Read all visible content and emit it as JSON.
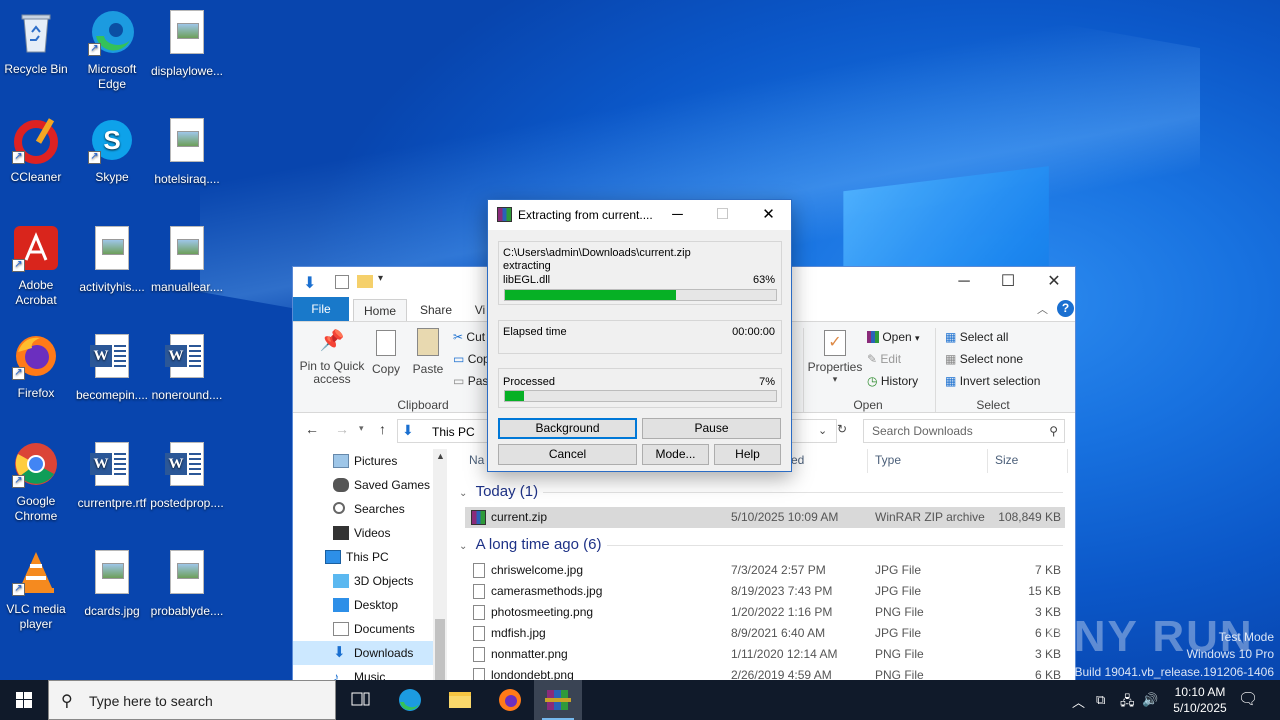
{
  "desktop": {
    "icons": [
      {
        "label": "Recycle Bin"
      },
      {
        "label": "Microsoft Edge"
      },
      {
        "label": "displaylowe..."
      },
      {
        "label": "CCleaner"
      },
      {
        "label": "Skype"
      },
      {
        "label": "hotelsiraq...."
      },
      {
        "label": "Adobe Acrobat"
      },
      {
        "label": "activityhis...."
      },
      {
        "label": "manuallear...."
      },
      {
        "label": "Firefox"
      },
      {
        "label": "becomepin...."
      },
      {
        "label": "noneround...."
      },
      {
        "label": "Google Chrome"
      },
      {
        "label": "currentpre.rtf"
      },
      {
        "label": "postedprop...."
      },
      {
        "label": "VLC media player"
      },
      {
        "label": "dcards.jpg"
      },
      {
        "label": "probablyde...."
      }
    ]
  },
  "explorer": {
    "tabs": {
      "file": "File",
      "home": "Home",
      "share": "Share",
      "view": "Vi"
    },
    "ribbon": {
      "pin": "Pin to Quick access",
      "copy": "Copy",
      "paste": "Paste",
      "cut": "Cut",
      "copy_path": "Cop",
      "paste_shortcut": "Pas",
      "clipboard": "Clipboard",
      "properties": "Properties",
      "open": "Open",
      "edit": "Edit",
      "history": "History",
      "open_group": "Open",
      "select_all": "Select all",
      "select_none": "Select none",
      "invert_selection": "Invert selection",
      "select_group": "Select"
    },
    "address": {
      "path": "This PC",
      "search_placeholder": "Search Downloads"
    },
    "nav": [
      {
        "label": "Pictures"
      },
      {
        "label": "Saved Games"
      },
      {
        "label": "Searches"
      },
      {
        "label": "Videos"
      },
      {
        "label": "This PC"
      },
      {
        "label": "3D Objects"
      },
      {
        "label": "Desktop"
      },
      {
        "label": "Documents"
      },
      {
        "label": "Downloads"
      },
      {
        "label": "Music"
      },
      {
        "label": "Pictures"
      }
    ],
    "columns": {
      "name": "Na",
      "date": "ed",
      "type": "Type",
      "size": "Size"
    },
    "groups": [
      {
        "label": "Today (1)"
      },
      {
        "label": "A long time ago (6)"
      }
    ],
    "today_files": [
      {
        "name": "current.zip",
        "date": "5/10/2025 10:09 AM",
        "type": "WinRAR ZIP archive",
        "size": "108,849 KB"
      }
    ],
    "old_files": [
      {
        "name": "chriswelcome.jpg",
        "date": "7/3/2024 2:57 PM",
        "type": "JPG File",
        "size": "7 KB"
      },
      {
        "name": "camerasmethods.jpg",
        "date": "8/19/2023 7:43 PM",
        "type": "JPG File",
        "size": "15 KB"
      },
      {
        "name": "photosmeeting.png",
        "date": "1/20/2022 1:16 PM",
        "type": "PNG File",
        "size": "3 KB"
      },
      {
        "name": "mdfish.jpg",
        "date": "8/9/2021 6:40 AM",
        "type": "JPG File",
        "size": "6 KB"
      },
      {
        "name": "nonmatter.png",
        "date": "1/11/2020 12:14 AM",
        "type": "PNG File",
        "size": "3 KB"
      },
      {
        "name": "londondebt.png",
        "date": "2/26/2019 4:59 AM",
        "type": "PNG File",
        "size": "6 KB"
      }
    ]
  },
  "winrar": {
    "title": "Extracting from current....",
    "archive_path": "C:\\Users\\admin\\Downloads\\current.zip",
    "action": "extracting",
    "current_file": "libEGL.dll",
    "file_percent": "63%",
    "file_progress": 0.63,
    "elapsed_label": "Elapsed time",
    "elapsed_value": "00:00:00",
    "processed_label": "Processed",
    "processed_percent": "7%",
    "processed_progress": 0.07,
    "buttons": {
      "background": "Background",
      "pause": "Pause",
      "cancel": "Cancel",
      "mode": "Mode...",
      "help": "Help"
    }
  },
  "taskbar": {
    "search_placeholder": "Type here to search",
    "time": "10:10 AM",
    "date": "5/10/2025"
  },
  "watermark": {
    "line1": "Test Mode",
    "line2": "Windows 10 Pro",
    "line3": "Build 19041.vb_release.191206-1406",
    "brand": "ANY RUN"
  },
  "colors": {
    "progress": "#06b025",
    "accent": "#0078d7",
    "taskbar": "#101a2a"
  }
}
